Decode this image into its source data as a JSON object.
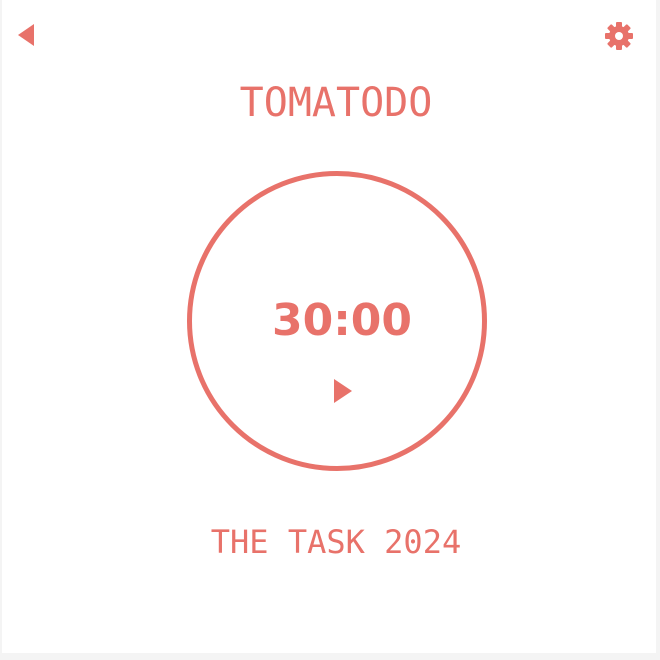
{
  "app": {
    "title": "TOMATODO",
    "accent_color": "#e8726a"
  },
  "header": {
    "back_icon": "back-arrow-icon",
    "settings_icon": "gear-icon"
  },
  "timer": {
    "time": "30:00",
    "play_icon": "play-icon"
  },
  "task": {
    "name": "THE TASK 2024"
  }
}
